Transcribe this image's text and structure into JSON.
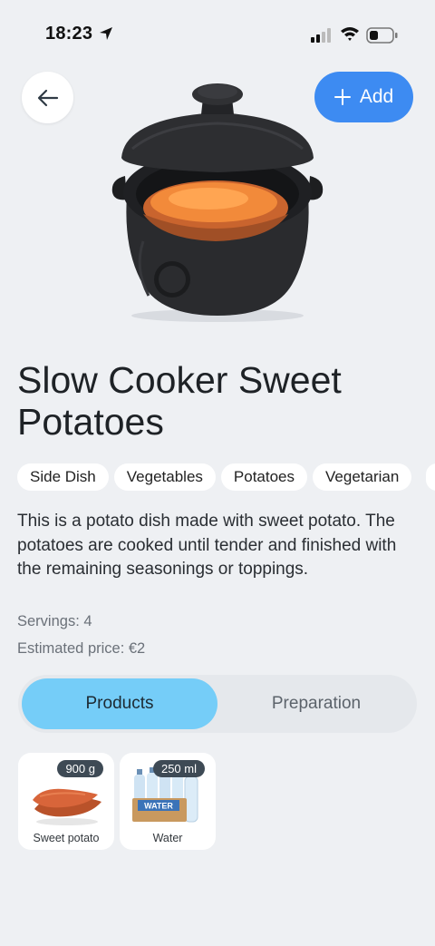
{
  "status_bar": {
    "time": "18:23"
  },
  "header": {
    "add_label": "Add"
  },
  "recipe": {
    "title": "Slow Cooker Sweet Potatoes",
    "tags": [
      "Side Dish",
      "Vegetables",
      "Potatoes",
      "Vegetarian"
    ],
    "description": "This is a potato dish made with sweet potato. The potatoes are cooked until tender and finished with the remaining seasonings or toppings.",
    "servings": "Servings: 4",
    "price": "Estimated price: €2"
  },
  "tabs": {
    "products": "Products",
    "preparation": "Preparation",
    "active": "products"
  },
  "products": [
    {
      "name": "Sweet potato",
      "quantity": "900 g"
    },
    {
      "name": "Water",
      "quantity": "250 ml",
      "package_label": "WATER"
    }
  ],
  "colors": {
    "accent": "#3d8bf2",
    "active_tab": "#75cdf8",
    "badge": "#3e4a55"
  }
}
